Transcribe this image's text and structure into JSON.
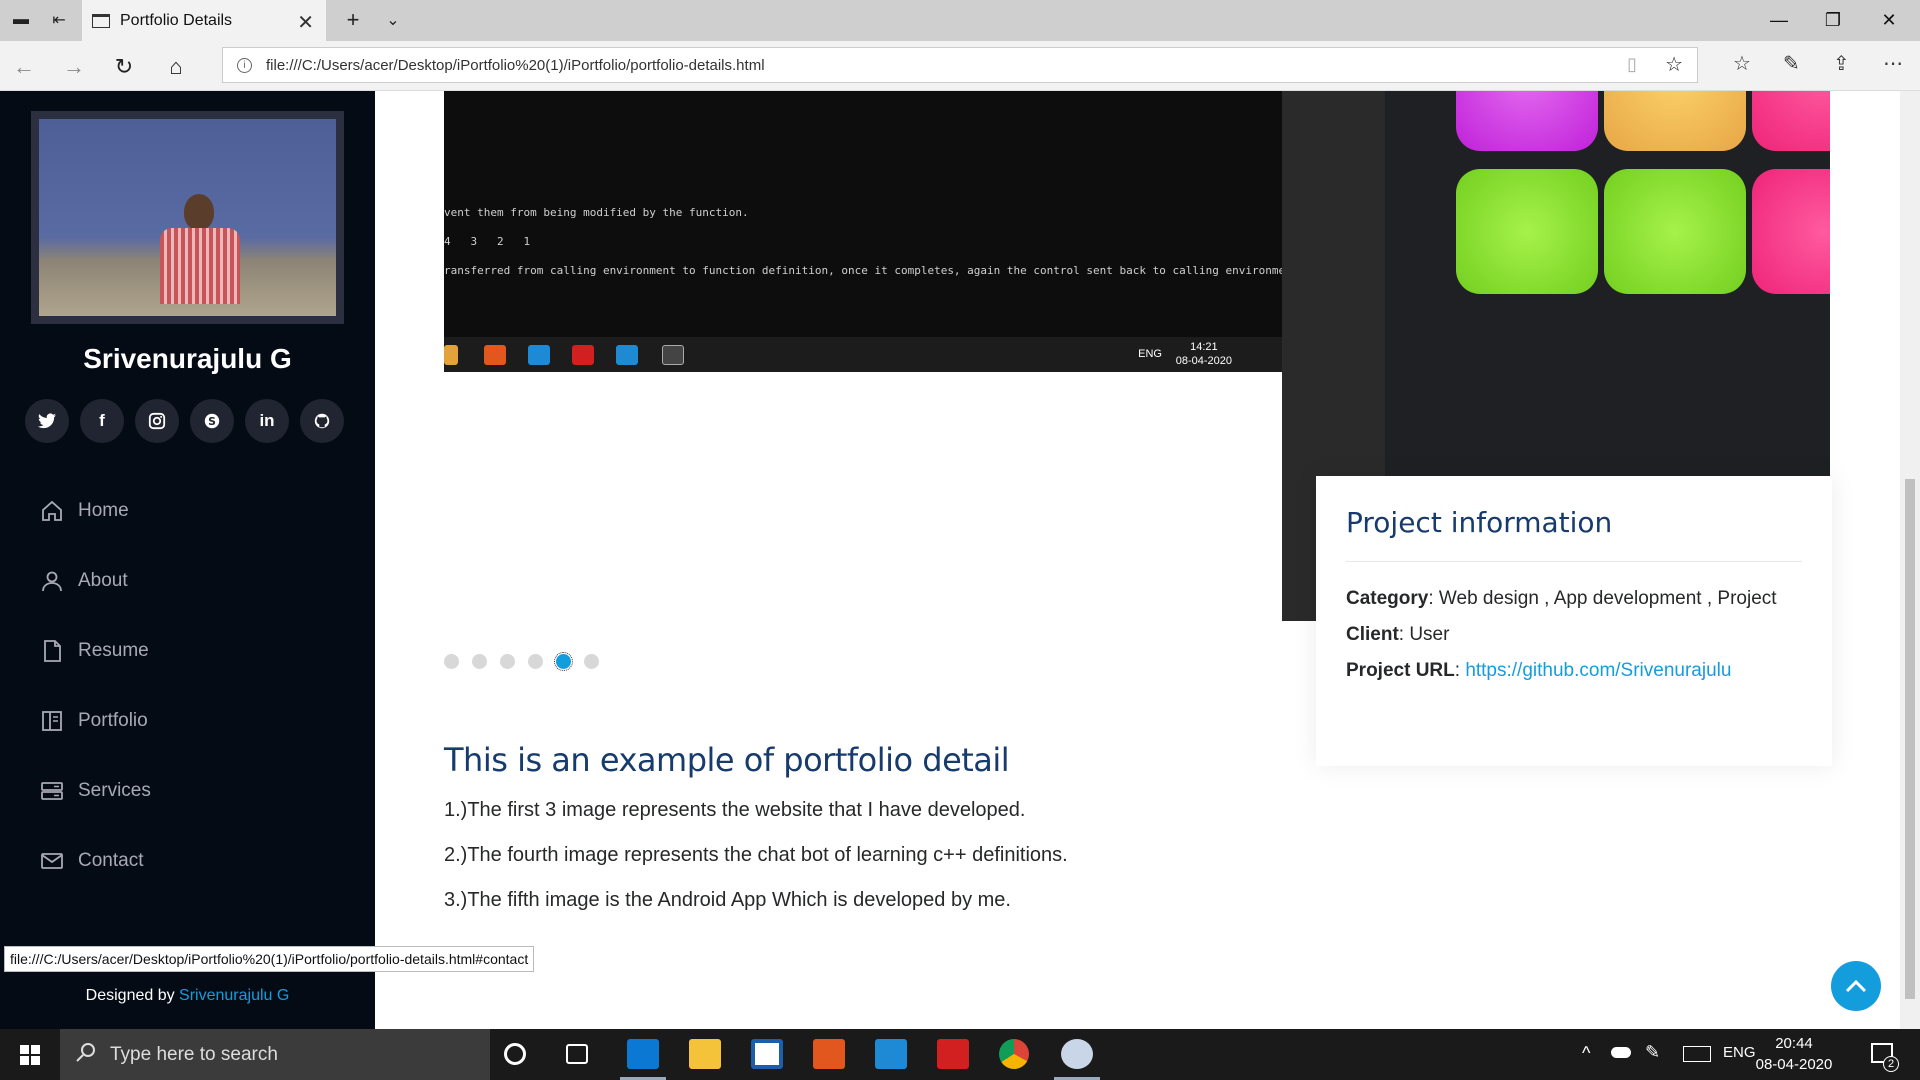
{
  "browser": {
    "tab_title": "Portfolio Details",
    "url": "file:///C:/Users/acer/Desktop/iPortfolio%20(1)/iPortfolio/portfolio-details.html",
    "status_url": "file:///C:/Users/acer/Desktop/iPortfolio%20(1)/iPortfolio/portfolio-details.html#contact"
  },
  "sidebar": {
    "name": "Srivenurajulu G",
    "socials": [
      "twitter-icon",
      "facebook-icon",
      "instagram-icon",
      "skype-icon",
      "linkedin-icon",
      "github-icon"
    ],
    "nav": [
      {
        "label": "Home",
        "icon": "home-icon"
      },
      {
        "label": "About",
        "icon": "person-icon"
      },
      {
        "label": "Resume",
        "icon": "file-icon"
      },
      {
        "label": "Portfolio",
        "icon": "book-icon"
      },
      {
        "label": "Services",
        "icon": "server-icon"
      },
      {
        "label": "Contact",
        "icon": "envelope-icon"
      }
    ],
    "credits_prefix": "Designed by ",
    "credits_link": "Srivenurajulu G"
  },
  "gallery": {
    "terminal_lines": [
      "vent them from being modified by the function.",
      "4   3   2   1",
      "ransferred from calling environment to function definition, once it completes, again the control sent back to calling environme"
    ],
    "embedded_clock_time": "14:21",
    "embedded_clock_date": "08-04-2020",
    "embedded_lang": "ENG",
    "dots_count": 6,
    "active_dot": 5
  },
  "project_info": {
    "heading": "Project information",
    "category_label": "Category",
    "category_value": ": Web design , App development , Project",
    "client_label": "Client",
    "client_value": ": User",
    "url_label": "Project URL",
    "url_sep": ": ",
    "url_value": "https://github.com/Srivenurajulu"
  },
  "detail": {
    "heading": "This is an example of portfolio detail",
    "lines": [
      "1.)The first 3 image represents the website that I have developed.",
      "2.)The fourth image represents the chat bot of learning c++ definitions.",
      "3.)The fifth image is the Android App Which is developed by me."
    ]
  },
  "taskbar": {
    "search_placeholder": "Type here to search",
    "lang": "ENG",
    "time": "20:44",
    "date": "08-04-2020",
    "notifications": "2"
  },
  "colors": {
    "accent": "#149ddd",
    "sidebar_bg": "#040b14",
    "heading": "#173b6c"
  }
}
